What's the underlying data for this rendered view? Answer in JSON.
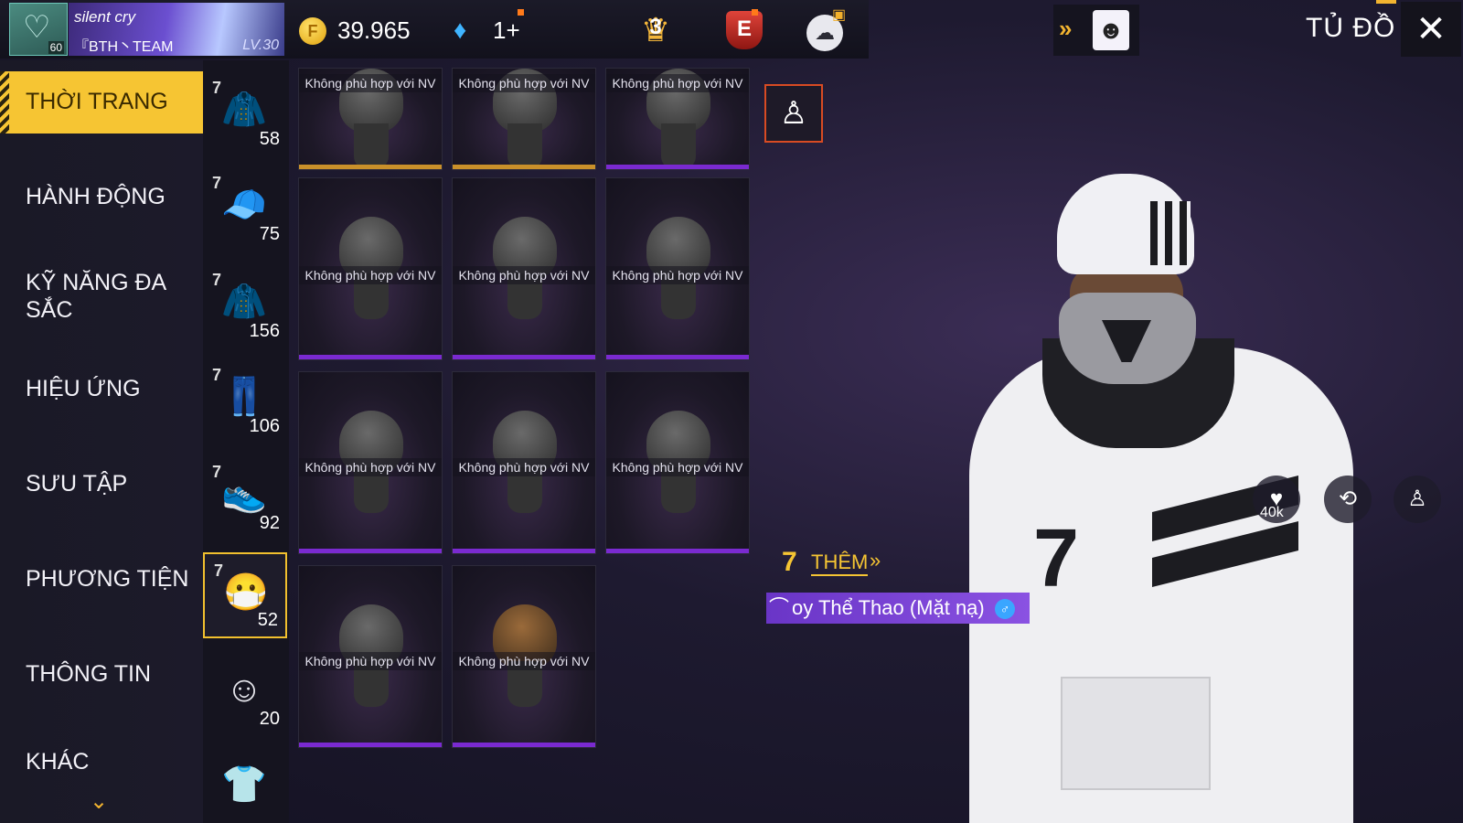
{
  "profile": {
    "avatar_level": "60",
    "player_name": "silent cry",
    "team": "『BTH丶TEAM",
    "level": "LV.30"
  },
  "currency": {
    "coins": "39.965",
    "diamonds": "1+"
  },
  "badges": {
    "rank": "3",
    "elite": "E"
  },
  "header": {
    "title": "TỦ ĐỒ"
  },
  "categories": [
    {
      "label": "THỜI TRANG",
      "active": true
    },
    {
      "label": "HÀNH ĐỘNG"
    },
    {
      "label": "KỸ NĂNG ĐA\nSẮC"
    },
    {
      "label": "HIỆU ỨNG"
    },
    {
      "label": "SƯU TẬP"
    },
    {
      "label": "PHƯƠNG TIỆN"
    },
    {
      "label": "THÔNG TIN"
    },
    {
      "label": "KHÁC"
    }
  ],
  "subcategories": [
    {
      "icon": "outfit-icon",
      "count": "58"
    },
    {
      "icon": "cap-icon",
      "count": "75"
    },
    {
      "icon": "jacket-icon",
      "count": "156"
    },
    {
      "icon": "pants-icon",
      "count": "106"
    },
    {
      "icon": "shoes-icon",
      "count": "92"
    },
    {
      "icon": "mask-icon",
      "count": "52",
      "selected": true
    },
    {
      "icon": "face-icon",
      "count": "20"
    },
    {
      "icon": "shirt-icon",
      "count": ""
    }
  ],
  "items": [
    {
      "note": "Không phù hợp với NV"
    },
    {
      "note": "Không phù hợp với NV"
    },
    {
      "note": "Không phù hợp với NV"
    },
    {
      "note": "Không phù hợp với NV"
    },
    {
      "note": "Không phù hợp với NV"
    },
    {
      "note": "Không phù hợp với NV"
    },
    {
      "note": "Không phù hợp với NV"
    },
    {
      "note": "Không phù hợp với NV"
    },
    {
      "note": "Không phù hợp với NV"
    },
    {
      "note": "Không phù hợp với NV"
    },
    {
      "note": "Không phù hợp với NV"
    }
  ],
  "preview": {
    "more_label": "THÊM",
    "item_name": "oy Thể Thao (Mặt nạ)",
    "likes": "40k"
  },
  "colors": {
    "accent": "#f6c533",
    "rarity_purple": "#7a2ad0",
    "name_bar": "#6a35c7"
  }
}
